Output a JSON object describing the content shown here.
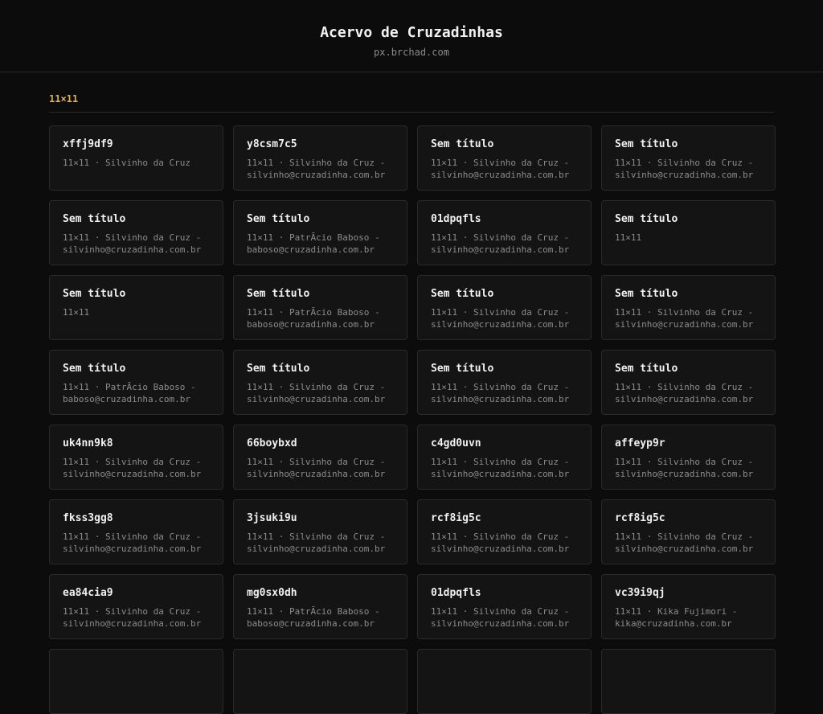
{
  "header": {
    "title": "Acervo de Cruzadinhas",
    "subtitle": "px.brchad.com"
  },
  "section": {
    "label": "11×11"
  },
  "cards": [
    {
      "title": "xffj9df9",
      "meta": "11×11 · Silvinho da Cruz"
    },
    {
      "title": "y8csm7c5",
      "meta": "11×11 · Silvinho da Cruz - silvinho@cruzadinha.com.br"
    },
    {
      "title": "Sem título",
      "meta": "11×11 · Silvinho da Cruz - silvinho@cruzadinha.com.br"
    },
    {
      "title": "Sem título",
      "meta": "11×11 · Silvinho da Cruz - silvinho@cruzadinha.com.br"
    },
    {
      "title": "Sem título",
      "meta": "11×11 · Silvinho da Cruz - silvinho@cruzadinha.com.br"
    },
    {
      "title": "Sem título",
      "meta": "11×11 · PatrÃcio Baboso - baboso@cruzadinha.com.br"
    },
    {
      "title": "01dpqfls",
      "meta": "11×11 · Silvinho da Cruz - silvinho@cruzadinha.com.br"
    },
    {
      "title": "Sem título",
      "meta": "11×11"
    },
    {
      "title": "Sem título",
      "meta": "11×11"
    },
    {
      "title": "Sem título",
      "meta": "11×11 · PatrÃcio Baboso - baboso@cruzadinha.com.br"
    },
    {
      "title": "Sem título",
      "meta": "11×11 · Silvinho da Cruz - silvinho@cruzadinha.com.br"
    },
    {
      "title": "Sem título",
      "meta": "11×11 · Silvinho da Cruz - silvinho@cruzadinha.com.br"
    },
    {
      "title": "Sem título",
      "meta": "11×11 · PatrÃcio Baboso - baboso@cruzadinha.com.br"
    },
    {
      "title": "Sem título",
      "meta": "11×11 · Silvinho da Cruz - silvinho@cruzadinha.com.br"
    },
    {
      "title": "Sem título",
      "meta": "11×11 · Silvinho da Cruz - silvinho@cruzadinha.com.br"
    },
    {
      "title": "Sem título",
      "meta": "11×11 · Silvinho da Cruz - silvinho@cruzadinha.com.br"
    },
    {
      "title": "uk4nn9k8",
      "meta": "11×11 · Silvinho da Cruz - silvinho@cruzadinha.com.br"
    },
    {
      "title": "66boybxd",
      "meta": "11×11 · Silvinho da Cruz - silvinho@cruzadinha.com.br"
    },
    {
      "title": "c4gd0uvn",
      "meta": "11×11 · Silvinho da Cruz - silvinho@cruzadinha.com.br"
    },
    {
      "title": "affeyp9r",
      "meta": "11×11 · Silvinho da Cruz - silvinho@cruzadinha.com.br"
    },
    {
      "title": "fkss3gg8",
      "meta": "11×11 · Silvinho da Cruz - silvinho@cruzadinha.com.br"
    },
    {
      "title": "3jsuki9u",
      "meta": "11×11 · Silvinho da Cruz - silvinho@cruzadinha.com.br"
    },
    {
      "title": "rcf8ig5c",
      "meta": "11×11 · Silvinho da Cruz - silvinho@cruzadinha.com.br"
    },
    {
      "title": "rcf8ig5c",
      "meta": "11×11 · Silvinho da Cruz - silvinho@cruzadinha.com.br"
    },
    {
      "title": "ea84cia9",
      "meta": "11×11 · Silvinho da Cruz - silvinho@cruzadinha.com.br"
    },
    {
      "title": "mg0sx0dh",
      "meta": "11×11 · PatrÃcio Baboso - baboso@cruzadinha.com.br"
    },
    {
      "title": "01dpqfls",
      "meta": "11×11 · Silvinho da Cruz - silvinho@cruzadinha.com.br"
    },
    {
      "title": "vc39i9qj",
      "meta": "11×11 · Kika Fujimori - kika@cruzadinha.com.br"
    },
    {
      "title": "",
      "meta": ""
    },
    {
      "title": "",
      "meta": ""
    },
    {
      "title": "",
      "meta": ""
    },
    {
      "title": "",
      "meta": ""
    }
  ]
}
